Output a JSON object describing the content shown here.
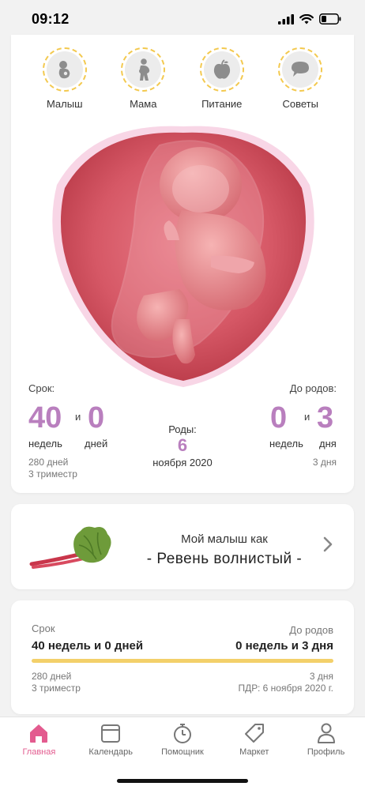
{
  "status": {
    "time": "09:12"
  },
  "top_nav": {
    "items": [
      {
        "label": "Малыш",
        "icon": "baby-icon"
      },
      {
        "label": "Мама",
        "icon": "pregnant-mother-icon"
      },
      {
        "label": "Питание",
        "icon": "apple-icon"
      },
      {
        "label": "Советы",
        "icon": "speech-bubble-icon"
      }
    ]
  },
  "term": {
    "label": "Срок:",
    "weeks": "40",
    "and": "и",
    "days": "0",
    "weeks_unit": "недель",
    "days_unit": "дней",
    "total_days": "280 дней",
    "trimester": "3 триместр"
  },
  "birth": {
    "label": "Роды:",
    "day": "6",
    "month_year": "ноября 2020"
  },
  "until_birth": {
    "label": "До родов:",
    "weeks": "0",
    "and": "и",
    "days": "3",
    "weeks_unit": "недель",
    "days_unit": "дня",
    "total_days": "3 дня"
  },
  "fruit_card": {
    "line1": "Мой малыш как",
    "line2": "- Ревень волнистый -"
  },
  "progress": {
    "left_label": "Срок",
    "left_value": "40 недель и 0 дней",
    "right_label": "До родов",
    "right_value": "0 недель и 3 дня",
    "fraction": 1.0,
    "left_sub1": "280 дней",
    "left_sub2": "3 триместр",
    "right_sub1": "3 дня",
    "right_sub2": "ПДР: 6 ноября 2020 г."
  },
  "tabs": [
    {
      "label": "Главная",
      "icon": "home-icon",
      "active": true
    },
    {
      "label": "Календарь",
      "icon": "calendar-icon",
      "active": false
    },
    {
      "label": "Помощник",
      "icon": "stopwatch-icon",
      "active": false
    },
    {
      "label": "Маркет",
      "icon": "tag-icon",
      "active": false
    },
    {
      "label": "Профиль",
      "icon": "person-icon",
      "active": false
    }
  ],
  "colors": {
    "accent_purple": "#b97fbe",
    "accent_pink": "#e35b8f",
    "progress_yellow": "#f3d06a",
    "dash_yellow": "#f3c94f"
  }
}
